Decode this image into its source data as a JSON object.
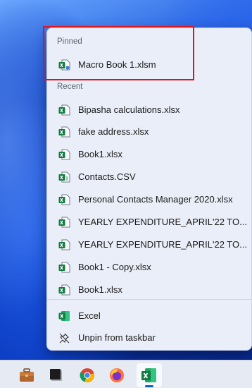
{
  "jumplist": {
    "pinned_header": "Pinned",
    "pinned_items": [
      {
        "label": "Macro Book 1.xlsm",
        "icon": "excel-macro-file-icon"
      }
    ],
    "recent_header": "Recent",
    "recent_items": [
      {
        "label": "Bipasha calculations.xlsx",
        "icon": "excel-file-icon"
      },
      {
        "label": "fake address.xlsx",
        "icon": "excel-file-icon"
      },
      {
        "label": "Book1.xlsx",
        "icon": "excel-file-icon"
      },
      {
        "label": "Contacts.CSV",
        "icon": "excel-csv-file-icon"
      },
      {
        "label": "Personal Contacts Manager 2020.xlsx",
        "icon": "excel-file-icon"
      },
      {
        "label": "YEARLY EXPENDITURE_APRIL'22 TO...",
        "icon": "excel-file-icon"
      },
      {
        "label": "YEARLY EXPENDITURE_APRIL'22 TO...",
        "icon": "excel-file-icon"
      },
      {
        "label": "Book1 - Copy.xlsx",
        "icon": "excel-file-icon"
      },
      {
        "label": "Book1.xlsx",
        "icon": "excel-file-icon"
      }
    ],
    "tasks": [
      {
        "label": "Excel",
        "icon": "excel-app-icon"
      },
      {
        "label": "Unpin from taskbar",
        "icon": "unpin-icon"
      }
    ]
  },
  "taskbar": {
    "apps": [
      {
        "name": "briefcase",
        "icon": "briefcase-icon"
      },
      {
        "name": "terminal",
        "icon": "terminal-icon"
      },
      {
        "name": "chrome",
        "icon": "chrome-icon"
      },
      {
        "name": "firefox",
        "icon": "firefox-icon"
      },
      {
        "name": "excel",
        "icon": "excel-app-icon",
        "active": true
      }
    ]
  },
  "colors": {
    "excel_green": "#107c41",
    "highlight_red": "#e2141b",
    "menu_bg": "#e9eef8"
  }
}
